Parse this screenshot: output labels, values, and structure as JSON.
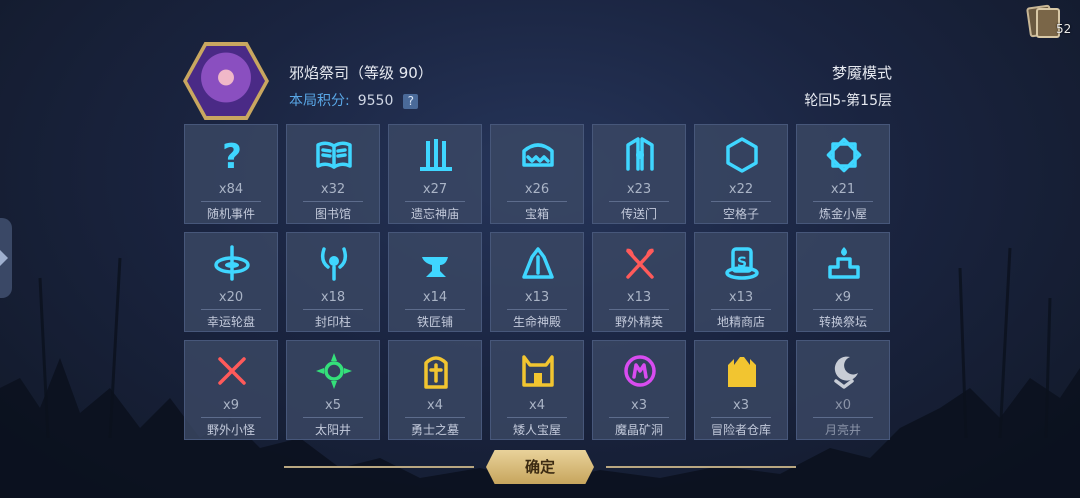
{
  "header": {
    "character_name": "邪焰祭司（等级 90）",
    "score_label": "本局积分:",
    "score_value": "9550",
    "help_symbol": "?",
    "mode": "梦魇模式",
    "cycle": "轮回5-第15层",
    "deck_count": "52"
  },
  "tiles": [
    {
      "count": "x84",
      "name": "随机事件",
      "icon": "question-mark-icon",
      "color": "#3fd6ff"
    },
    {
      "count": "x32",
      "name": "图书馆",
      "icon": "open-book-icon",
      "color": "#3fd6ff"
    },
    {
      "count": "x27",
      "name": "遗忘神庙",
      "icon": "temple-pillars-icon",
      "color": "#3fd6ff"
    },
    {
      "count": "x26",
      "name": "宝箱",
      "icon": "treasure-chest-icon",
      "color": "#3fd6ff"
    },
    {
      "count": "x23",
      "name": "传送门",
      "icon": "portal-icon",
      "color": "#3fd6ff"
    },
    {
      "count": "x22",
      "name": "空格子",
      "icon": "hexagon-icon",
      "color": "#3fd6ff"
    },
    {
      "count": "x21",
      "name": "炼金小屋",
      "icon": "alchemy-diamond-icon",
      "color": "#3fd6ff"
    },
    {
      "count": "x20",
      "name": "幸运轮盘",
      "icon": "lucky-wheel-icon",
      "color": "#3fd6ff"
    },
    {
      "count": "x18",
      "name": "封印柱",
      "icon": "seal-pillar-icon",
      "color": "#3fd6ff"
    },
    {
      "count": "x14",
      "name": "铁匠铺",
      "icon": "anvil-icon",
      "color": "#3fd6ff"
    },
    {
      "count": "x13",
      "name": "生命神殿",
      "icon": "life-shrine-icon",
      "color": "#3fd6ff"
    },
    {
      "count": "x13",
      "name": "野外精英",
      "icon": "crossed-axes-icon",
      "color": "#ff5a5a"
    },
    {
      "count": "x13",
      "name": "地精商店",
      "icon": "goblin-shop-icon",
      "color": "#3fd6ff"
    },
    {
      "count": "x9",
      "name": "转换祭坛",
      "icon": "altar-icon",
      "color": "#3fd6ff"
    },
    {
      "count": "x9",
      "name": "野外小怪",
      "icon": "crossed-swords-icon",
      "color": "#ff5a5a"
    },
    {
      "count": "x5",
      "name": "太阳井",
      "icon": "sun-well-icon",
      "color": "#34e07a"
    },
    {
      "count": "x4",
      "name": "勇士之墓",
      "icon": "tomb-icon",
      "color": "#f2c530"
    },
    {
      "count": "x4",
      "name": "矮人宝屋",
      "icon": "dwarf-vault-icon",
      "color": "#f2c530"
    },
    {
      "count": "x3",
      "name": "魔晶矿洞",
      "icon": "crystal-mine-icon",
      "color": "#d84cf0"
    },
    {
      "count": "x3",
      "name": "冒险者仓库",
      "icon": "warehouse-icon",
      "color": "#f2c530"
    },
    {
      "count": "x0",
      "name": "月亮井",
      "icon": "moon-well-icon",
      "color": "#c8cdd6"
    }
  ],
  "footer": {
    "confirm_label": "确定"
  },
  "colors": {
    "accent_blue": "#59a7e6",
    "tile_bg": "#3a4864",
    "gold": "#c9a760"
  }
}
